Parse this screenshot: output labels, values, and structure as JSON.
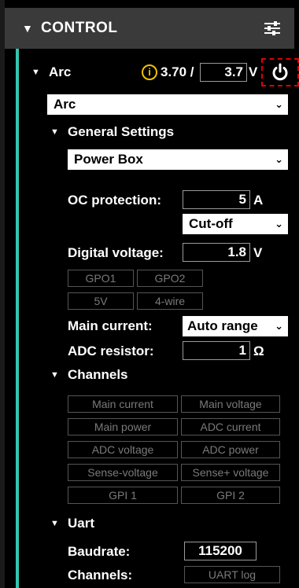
{
  "header": {
    "title": "CONTROL",
    "icon": "sliders-icon"
  },
  "arc": {
    "label": "Arc",
    "reading": "3.70 /",
    "setpoint": "3.7",
    "unit": "V",
    "info_icon": "info-icon",
    "power_icon": "power-icon",
    "device_select": "Arc"
  },
  "general": {
    "title": "General Settings",
    "power_select": "Power Box",
    "oc_label": "OC protection:",
    "oc_value": "5",
    "oc_unit": "A",
    "oc_mode": "Cut-off",
    "digital_label": "Digital voltage:",
    "digital_value": "1.8",
    "digital_unit": "V",
    "chips": [
      "GPO1",
      "GPO2",
      "5V",
      "4-wire"
    ],
    "main_current_label": "Main current:",
    "main_current_value": "Auto range",
    "adc_label": "ADC resistor:",
    "adc_value": "1",
    "adc_unit": "Ω"
  },
  "channels": {
    "title": "Channels",
    "items": [
      "Main current",
      "Main voltage",
      "Main power",
      "ADC current",
      "ADC voltage",
      "ADC power",
      "Sense-voltage",
      "Sense+ voltage",
      "GPI 1",
      "GPI 2"
    ]
  },
  "uart": {
    "title": "Uart",
    "baud_label": "Baudrate:",
    "baud_value": "115200",
    "channels_label": "Channels:",
    "channels_value": "UART log"
  },
  "colors": {
    "accent": "#33c6b0",
    "warning": "#f2c200",
    "highlight": "#e00000"
  }
}
